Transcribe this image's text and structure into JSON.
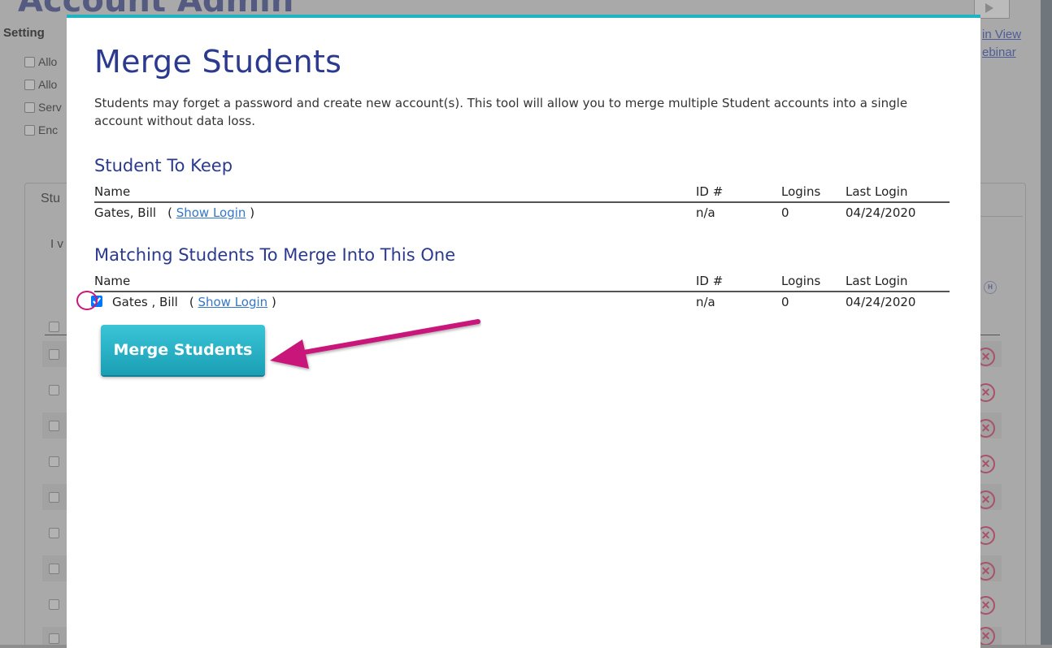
{
  "background": {
    "heading": "Account Admin",
    "settings_label": "Setting",
    "options": [
      "Allo",
      "Allo",
      "Serv",
      "Enc"
    ],
    "panel_title": "Stu",
    "panel_sub": "I v",
    "links": {
      "train_view": "in View",
      "webinar": "ebinar"
    },
    "row_action_icon": "x-circle-icon"
  },
  "modal": {
    "title": "Merge Students",
    "description": "Students may forget a password and create new account(s). This tool will allow you to merge multiple Student accounts into a single account without data loss.",
    "keep_section": {
      "heading": "Student To Keep",
      "columns": [
        "Name",
        "ID #",
        "Logins",
        "Last Login"
      ],
      "rows": [
        {
          "name": "Gates, Bill",
          "link": "Show Login",
          "id": "n/a",
          "logins": "0",
          "last_login": "04/24/2020"
        }
      ]
    },
    "merge_section": {
      "heading": "Matching Students To Merge Into This One",
      "columns": [
        "Name",
        "ID #",
        "Logins",
        "Last Login"
      ],
      "rows": [
        {
          "checked": true,
          "name": "Gates , Bill",
          "link": "Show Login",
          "id": "n/a",
          "logins": "0",
          "last_login": "04/24/2020"
        }
      ]
    },
    "merge_button_label": "Merge Students"
  },
  "colors": {
    "title": "#2b3a8f",
    "accent": "#1fb4c4",
    "link": "#3477c9",
    "annotation": "#c8197a"
  }
}
